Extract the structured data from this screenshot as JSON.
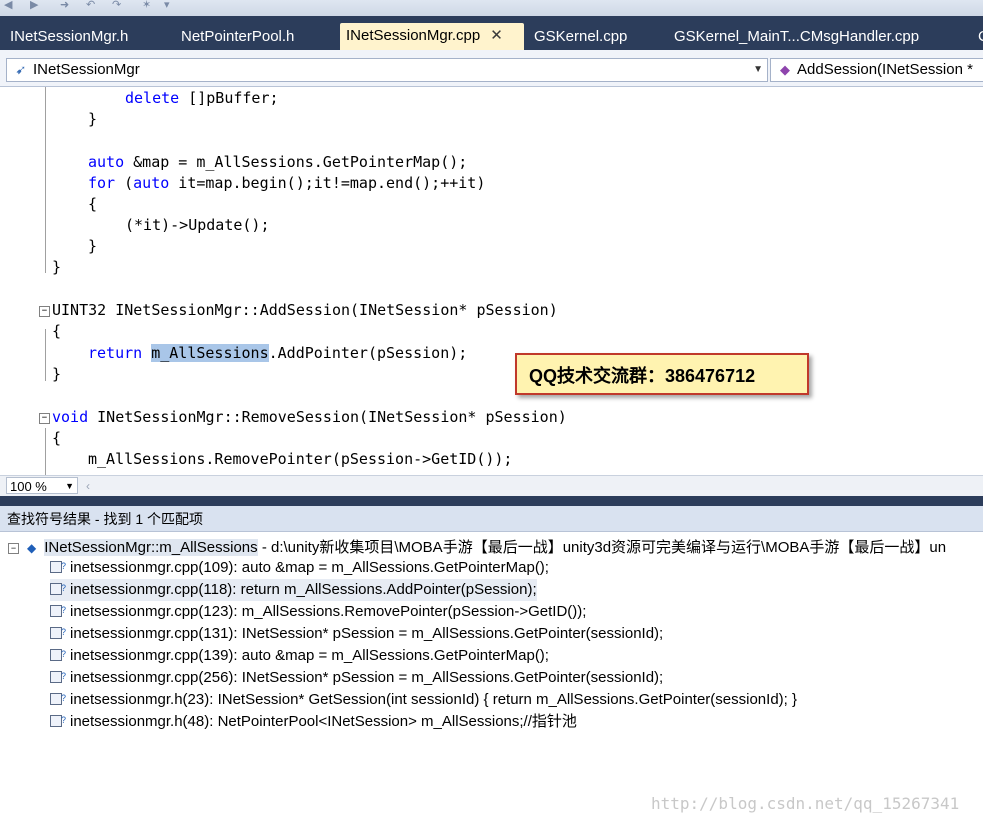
{
  "tabs": [
    {
      "label": "INetSessionMgr.h",
      "active": false
    },
    {
      "label": "NetPointerPool.h",
      "active": false
    },
    {
      "label": "INetSessionMgr.cpp",
      "active": true,
      "close": "✕"
    },
    {
      "label": "GSKernel.cpp",
      "active": false
    },
    {
      "label": "GSKernel_MainT...CMsgHandler.cpp",
      "active": false
    },
    {
      "label": "C",
      "active": false
    }
  ],
  "navbar": {
    "class_combo": "INetSessionMgr",
    "member_combo": "AddSession(INetSession *"
  },
  "code": {
    "l1_kw": "delete",
    "l1_rest": " []pBuffer;",
    "l2": "}",
    "l3_kw": "auto",
    "l3_rest": " &map = m_AllSessions.GetPointerMap();",
    "l4_kw1": "for",
    "l4_mid": " (",
    "l4_kw2": "auto",
    "l4_rest": " it=map.begin();it!=map.end();++it)",
    "l5": "{",
    "l6": "(*it)->Update();",
    "l7": "}",
    "l8": "}",
    "l9": "UINT32 INetSessionMgr::AddSession(INetSession* pSession)",
    "l10": "{",
    "l11_kw": "return",
    "l11_sp": " ",
    "l11_hl": "m_AllSessions",
    "l11_rest": ".AddPointer(pSession);",
    "l12": "}",
    "l13_kw": "void",
    "l13_rest": " INetSessionMgr::RemoveSession(INetSession* pSession)",
    "l14": "{",
    "l15": "m_AllSessions.RemovePointer(pSession->GetID());"
  },
  "annotation": "QQ技术交流群：386476712",
  "zoom": "100 %",
  "results_panel": {
    "title": "查找符号结果 - 找到 1 个匹配项",
    "root_symbol": "INetSessionMgr::m_AllSessions",
    "root_path": " - d:\\unity新收集项目\\MOBA手游【最后一战】unity3d资源可完美编译与运行\\MOBA手游【最后一战】un",
    "items": [
      "inetsessionmgr.cpp(109): auto &map = m_AllSessions.GetPointerMap();",
      "inetsessionmgr.cpp(118): return m_AllSessions.AddPointer(pSession);",
      "inetsessionmgr.cpp(123): m_AllSessions.RemovePointer(pSession->GetID());",
      "inetsessionmgr.cpp(131): INetSession* pSession = m_AllSessions.GetPointer(sessionId);",
      "inetsessionmgr.cpp(139): auto &map = m_AllSessions.GetPointerMap();",
      "inetsessionmgr.cpp(256): INetSession* pSession = m_AllSessions.GetPointer(sessionId);",
      "inetsessionmgr.h(23): INetSession* GetSession(int sessionId) { return m_AllSessions.GetPointer(sessionId); }",
      "inetsessionmgr.h(48): NetPointerPool<INetSession> m_AllSessions;//指针池"
    ]
  },
  "watermark": "http://blog.csdn.net/qq_15267341"
}
